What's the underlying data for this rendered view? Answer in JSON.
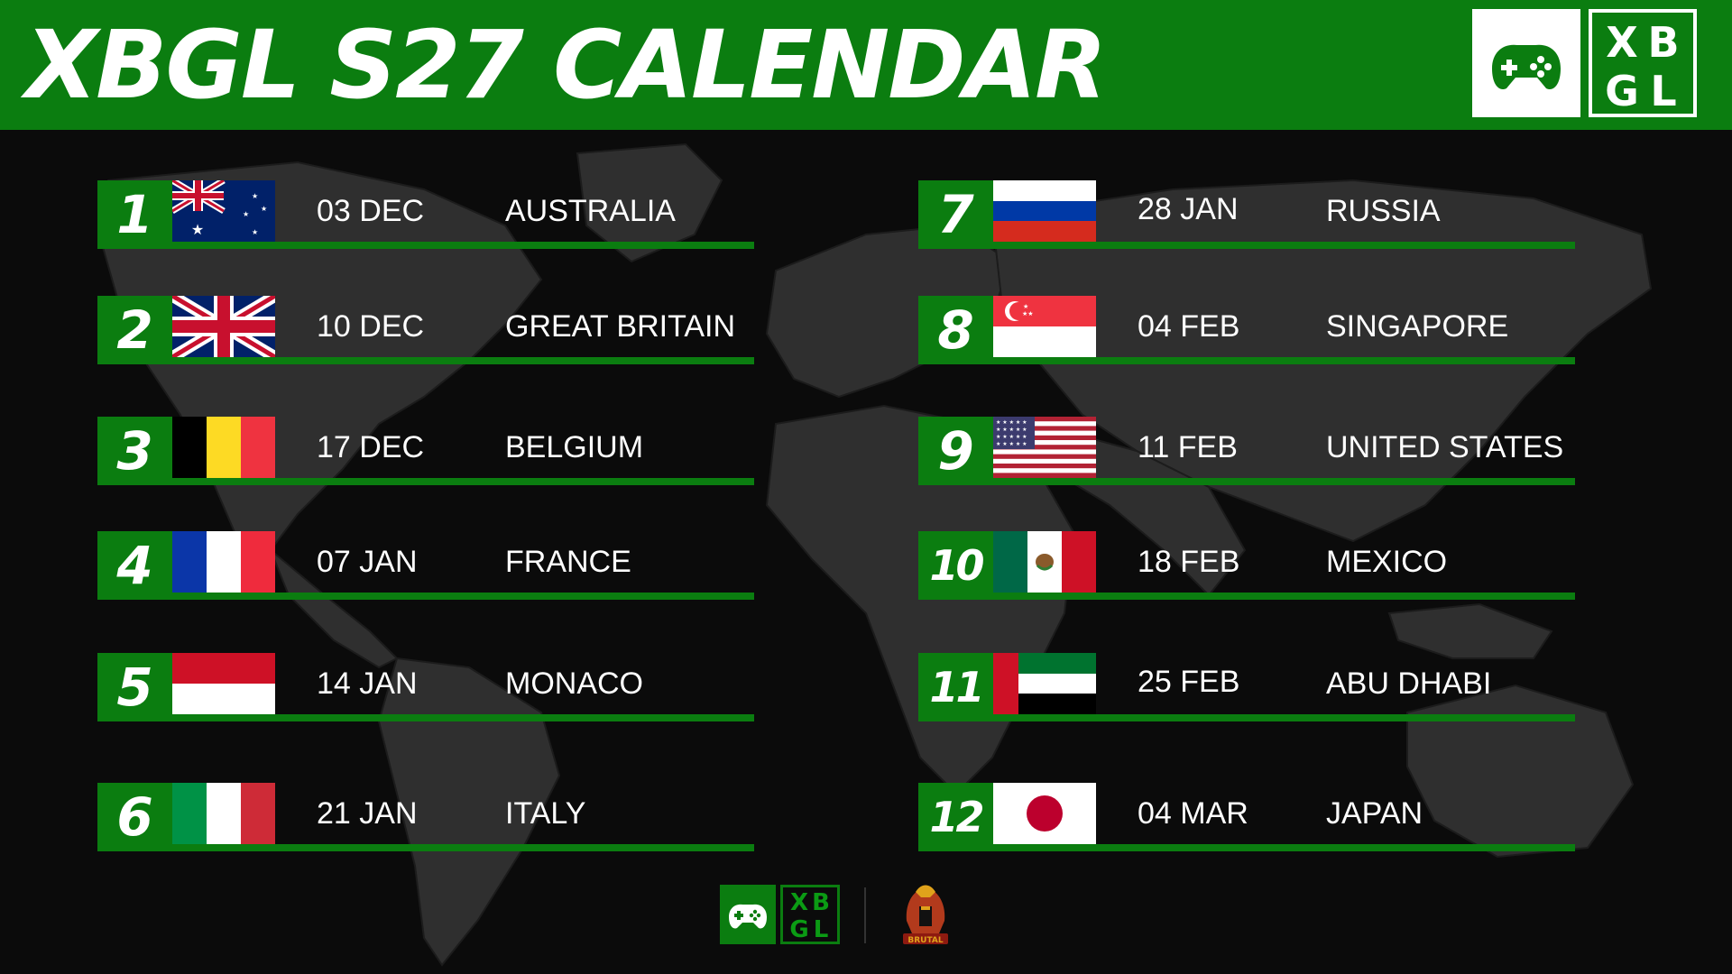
{
  "header": {
    "title": "XBGL S27 CALENDAR",
    "logo_icon": "game-controller-icon",
    "logo_letters": [
      "X",
      "B",
      "G",
      "L"
    ]
  },
  "colors": {
    "accent_green": "#0b7d10",
    "background": "#0b0b0b",
    "map": "#2f2f2f",
    "text": "#ffffff"
  },
  "races": [
    {
      "number": "1",
      "date": "03 DEC",
      "country": "AUSTRALIA",
      "flag": "australia-flag"
    },
    {
      "number": "2",
      "date": "10 DEC",
      "country": "GREAT BRITAIN",
      "flag": "great-britain-flag"
    },
    {
      "number": "3",
      "date": "17 DEC",
      "country": "BELGIUM",
      "flag": "belgium-flag"
    },
    {
      "number": "4",
      "date": "07 JAN",
      "country": "FRANCE",
      "flag": "france-flag"
    },
    {
      "number": "5",
      "date": "14 JAN",
      "country": "MONACO",
      "flag": "monaco-flag"
    },
    {
      "number": "6",
      "date": "21 JAN",
      "country": "ITALY",
      "flag": "italy-flag"
    },
    {
      "number": "7",
      "date": "28 JAN",
      "country": "RUSSIA",
      "flag": "russia-flag"
    },
    {
      "number": "8",
      "date": "04 FEB",
      "country": "SINGAPORE",
      "flag": "singapore-flag"
    },
    {
      "number": "9",
      "date": "11 FEB",
      "country": "UNITED STATES",
      "flag": "united-states-flag"
    },
    {
      "number": "10",
      "date": "18 FEB",
      "country": "MEXICO",
      "flag": "mexico-flag"
    },
    {
      "number": "11",
      "date": "25 FEB",
      "country": "ABU DHABI",
      "flag": "uae-flag"
    },
    {
      "number": "12",
      "date": "04 MAR",
      "country": "JAPAN",
      "flag": "japan-flag"
    }
  ],
  "footer": {
    "xbgl_letters": [
      "X",
      "B",
      "G",
      "L"
    ],
    "partner_logo": "brutal-spartan-helmet-logo",
    "partner_logo_text": "BRUTAL"
  }
}
